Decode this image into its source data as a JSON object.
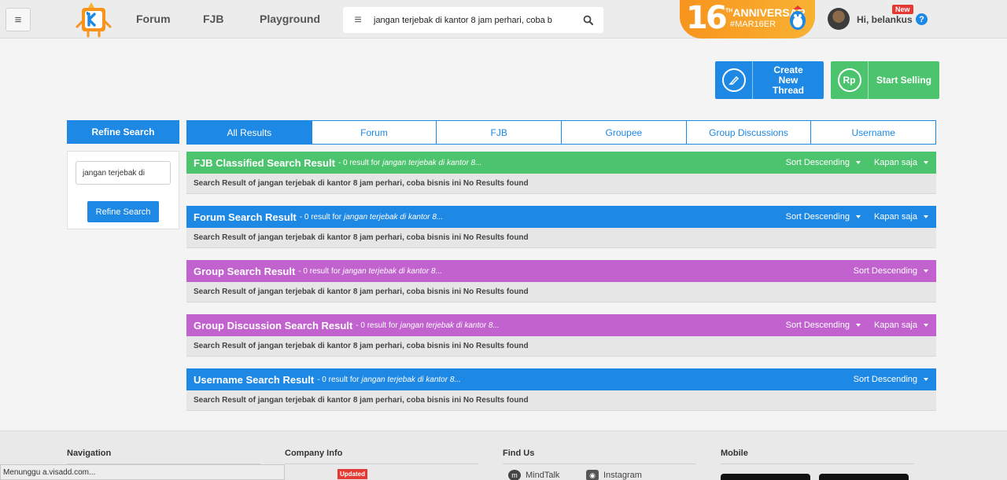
{
  "header": {
    "nav": [
      "Forum",
      "FJB",
      "Playground"
    ],
    "search_query": "jangan terjebak di kantor 8 jam perhari, coba b",
    "anniversary": {
      "number": "16",
      "text": "ANNIVERSAR",
      "hashtag": "#MAR16ER",
      "sup": "TH"
    },
    "greeting": "Hi, belankus",
    "new_badge": "New",
    "help": "?"
  },
  "actions": {
    "create_thread": "Create New Thread",
    "start_selling": "Start Selling",
    "rp": "Rp"
  },
  "sidebar": {
    "title": "Refine Search",
    "input_value": "jangan terjebak di",
    "button": "Refine Search"
  },
  "tabs": [
    "All Results",
    "Forum",
    "FJB",
    "Groupee",
    "Group Discussions",
    "Username"
  ],
  "results": [
    {
      "title": "FJB Classified Search Result",
      "count_text": "- 0 result for",
      "keyword": "jangan terjebak di kantor 8...",
      "sort": "Sort Descending",
      "time": "Kapan saja",
      "body": "Search Result of jangan terjebak di kantor 8 jam perhari, coba bisnis ini No Results found"
    },
    {
      "title": "Forum Search Result",
      "count_text": "- 0 result for",
      "keyword": "jangan terjebak di kantor 8...",
      "sort": "Sort Descending",
      "time": "Kapan saja",
      "body": "Search Result of jangan terjebak di kantor 8 jam perhari, coba bisnis ini No Results found"
    },
    {
      "title": "Group Search Result",
      "count_text": "- 0 result for",
      "keyword": "jangan terjebak di kantor 8...",
      "sort": "Sort Descending",
      "body": "Search Result of jangan terjebak di kantor 8 jam perhari, coba bisnis ini No Results found"
    },
    {
      "title": "Group Discussion Search Result",
      "count_text": "- 0 result for",
      "keyword": "jangan terjebak di kantor 8...",
      "sort": "Sort Descending",
      "time": "Kapan saja",
      "body": "Search Result of jangan terjebak di kantor 8 jam perhari, coba bisnis ini No Results found"
    },
    {
      "title": "Username Search Result",
      "count_text": "- 0 result for",
      "keyword": "jangan terjebak di kantor 8...",
      "sort": "Sort Descending",
      "body": "Search Result of jangan terjebak di kantor 8 jam perhari, coba bisnis ini No Results found"
    }
  ],
  "footer": {
    "navigation": "Navigation",
    "company_info": "Company Info",
    "updated_badge": "Updated",
    "find_us": "Find Us",
    "mindtalk": "MindTalk",
    "instagram": "Instagram",
    "mobile": "Mobile"
  },
  "status_bar": "Menunggu a.visadd.com...",
  "colors": {
    "blue": "#1e88e5",
    "green": "#4cc36d",
    "purple": "#c162cf",
    "orange": "#f7941d",
    "red": "#e53935"
  }
}
